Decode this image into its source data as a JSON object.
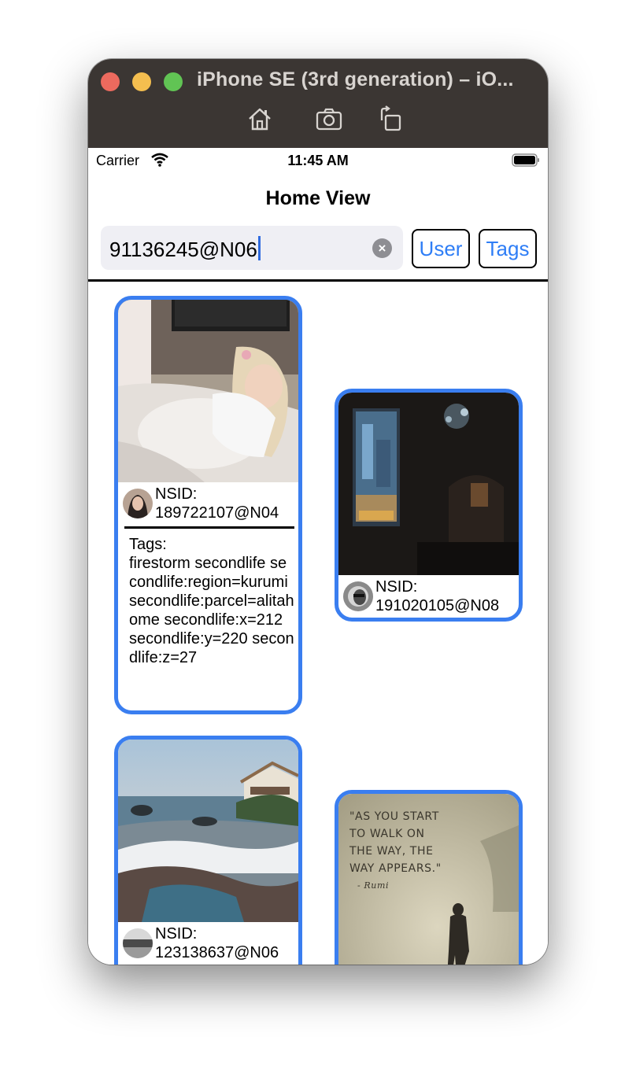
{
  "window": {
    "title": "iPhone SE (3rd generation) – iO...",
    "toolbar_icons": [
      "home-icon",
      "screenshot-icon",
      "rotate-icon"
    ],
    "colors": {
      "titlebar": "#3b3633",
      "close": "#ed6a5e",
      "minimize": "#f4be4f",
      "zoom": "#61c454"
    }
  },
  "status_bar": {
    "carrier": "Carrier",
    "time": "11:45 AM"
  },
  "nav": {
    "title": "Home View"
  },
  "search": {
    "value": "91136245@N06",
    "clear_icon": "clear-icon"
  },
  "buttons": {
    "user": "User",
    "tags": "Tags"
  },
  "accent_color": "#3a7ef0",
  "cards": [
    {
      "nsid_label": "NSID:",
      "nsid": "189722107@N04",
      "tags_label": "Tags:",
      "tags": "firestorm secondlife secondlife:region=kurumi secondlife:parcel=alitahome secondlife:x=212 secondlife:y=220 secondlife:z=27"
    },
    {
      "nsid_label": "NSID:",
      "nsid": "191020105@N08"
    },
    {
      "nsid_label": "NSID:",
      "nsid": "123138637@N06"
    },
    {
      "image_text": {
        "line1": "\"AS YOU START",
        "line2": "TO WALK ON",
        "line3": "THE WAY, THE",
        "line4": "WAY APPEARS.\"",
        "attribution": "- Rumi"
      }
    }
  ]
}
